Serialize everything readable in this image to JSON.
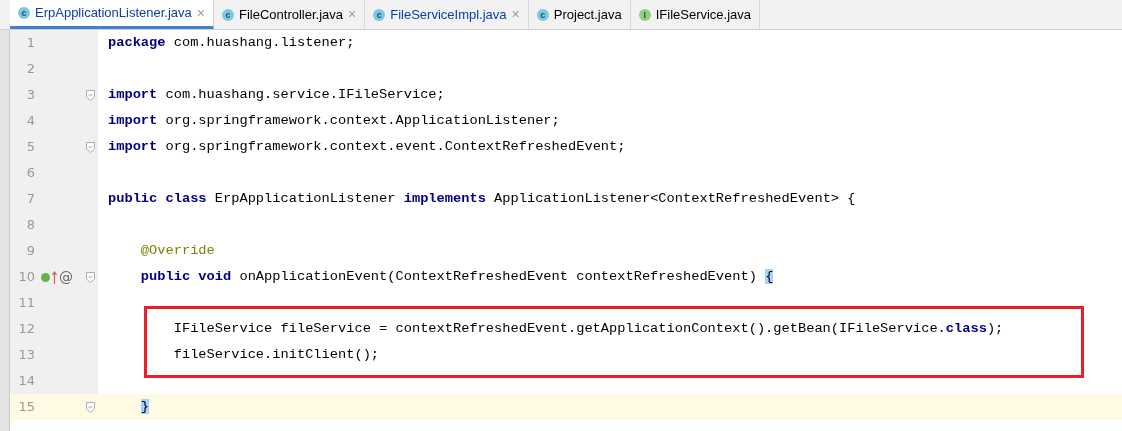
{
  "tabs": [
    {
      "label": "ErpApplicationListener.java",
      "kind": "class",
      "icon_letter": "c",
      "selected": true,
      "modified": true,
      "close": "×"
    },
    {
      "label": "FileController.java",
      "kind": "class",
      "icon_letter": "c",
      "selected": false,
      "modified": false,
      "close": "×"
    },
    {
      "label": "FileServiceImpl.java",
      "kind": "class",
      "icon_letter": "c",
      "selected": false,
      "modified": true,
      "close": "×"
    },
    {
      "label": "Project.java",
      "kind": "class",
      "icon_letter": "c",
      "selected": false,
      "modified": false
    },
    {
      "label": "IFileService.java",
      "kind": "interface",
      "icon_letter": "I",
      "selected": false,
      "modified": false
    }
  ],
  "editor": {
    "lines": [
      {
        "number": "1",
        "fold": false,
        "current": false,
        "tokens": [
          {
            "kind": "keyword",
            "text": "package"
          },
          {
            "kind": "plain",
            "text": " com.huashang.listener;"
          }
        ]
      },
      {
        "number": "2",
        "fold": false,
        "current": false
      },
      {
        "number": "3",
        "fold": true,
        "current": false,
        "tokens": [
          {
            "kind": "keyword",
            "text": "import"
          },
          {
            "kind": "plain",
            "text": " com.huashang.service.IFileService;"
          }
        ]
      },
      {
        "number": "4",
        "fold": false,
        "current": false,
        "tokens": [
          {
            "kind": "keyword",
            "text": "import"
          },
          {
            "kind": "plain",
            "text": " org.springframework.context.ApplicationListener;"
          }
        ]
      },
      {
        "number": "5",
        "fold": true,
        "current": false,
        "tokens": [
          {
            "kind": "keyword",
            "text": "import"
          },
          {
            "kind": "plain",
            "text": " org.springframework.context.event.ContextRefreshedEvent;"
          }
        ]
      },
      {
        "number": "6",
        "fold": false,
        "current": false
      },
      {
        "number": "7",
        "fold": false,
        "current": false,
        "tokens": [
          {
            "kind": "keyword",
            "text": "public class"
          },
          {
            "kind": "plain",
            "text": " ErpApplicationListener "
          },
          {
            "kind": "keyword",
            "text": "implements"
          },
          {
            "kind": "plain",
            "text": " ApplicationListener<ContextRefreshedEvent> {"
          }
        ]
      },
      {
        "number": "8",
        "fold": false,
        "current": false
      },
      {
        "number": "9",
        "fold": false,
        "current": false,
        "tokens": [
          {
            "kind": "annotation",
            "text": "    @Override"
          }
        ]
      },
      {
        "number": "10",
        "fold": true,
        "current": false,
        "markers": {
          "annotation": "@"
        },
        "tokens": [
          {
            "kind": "keyword",
            "text": "    public void"
          },
          {
            "kind": "plain",
            "text": " onApplicationEvent(ContextRefreshedEvent contextRefreshedEvent) "
          },
          {
            "kind": "brace",
            "text": "{"
          }
        ]
      },
      {
        "number": "11",
        "fold": false,
        "current": false
      },
      {
        "number": "12",
        "fold": false,
        "current": false,
        "tokens": [
          {
            "kind": "plain",
            "text": "        IFileService fileService = contextRefreshedEvent.getApplicationContext().getBean(IFileService."
          },
          {
            "kind": "keyword",
            "text": "class"
          },
          {
            "kind": "plain",
            "text": ");"
          }
        ]
      },
      {
        "number": "13",
        "fold": false,
        "current": false,
        "tokens": [
          {
            "kind": "plain",
            "text": "        fileService.initClient();"
          }
        ]
      },
      {
        "number": "14",
        "fold": false,
        "current": false
      },
      {
        "number": "15",
        "fold": true,
        "current": true,
        "tokens": [
          {
            "kind": "brace",
            "text": "    }"
          }
        ]
      }
    ]
  }
}
